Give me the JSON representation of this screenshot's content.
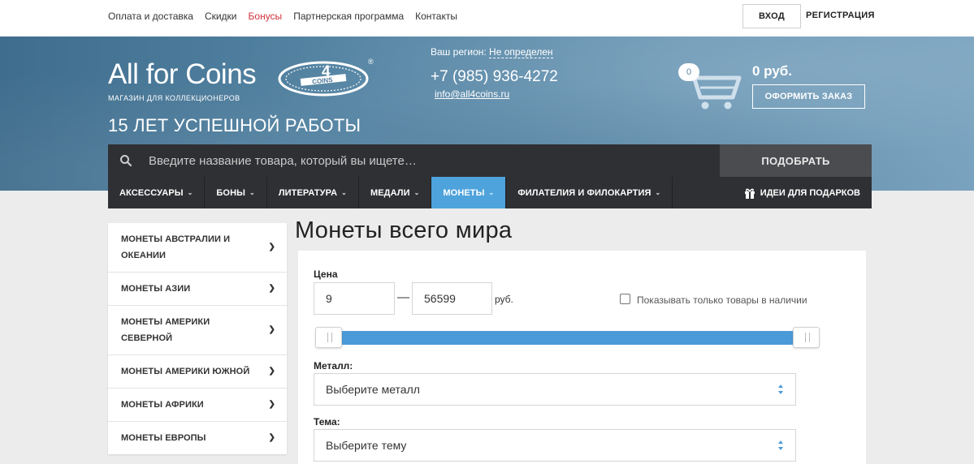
{
  "topbar": {
    "links": [
      "Оплата и доставка",
      "Скидки",
      "Бонусы",
      "Партнерская программа",
      "Контакты"
    ],
    "login": "ВХОД",
    "register": "РЕГИСТРАЦИЯ"
  },
  "header": {
    "logo": "All for Coins",
    "logo_sub": "МАГАЗИН ДЛЯ КОЛЛЕКЦИОНЕРОВ",
    "tagline": "15 ЛЕТ УСПЕШНОЙ РАБОТЫ",
    "region_label": "Ваш регион:",
    "region_value": "Не определен",
    "phone": "+7 (985) 936-4272",
    "email": "info@all4coins.ru",
    "cart_count": "0",
    "cart_sum": "0 руб.",
    "order_button": "ОФОРМИТЬ ЗАКАЗ"
  },
  "search": {
    "placeholder": "Введите название товара, который вы ищете…",
    "button": "ПОДОБРАТЬ"
  },
  "nav": {
    "items": [
      "АКСЕССУАРЫ",
      "БОНЫ",
      "ЛИТЕРАТУРА",
      "МЕДАЛИ",
      "МОНЕТЫ",
      "ФИЛАТЕЛИЯ И ФИЛОКАРТИЯ"
    ],
    "active": "МОНЕТЫ",
    "gift": "ИДЕИ ДЛЯ ПОДАРКОВ"
  },
  "sidebar": {
    "items": [
      "МОНЕТЫ АВСТРАЛИИ И ОКЕАНИИ",
      "МОНЕТЫ АЗИИ",
      "МОНЕТЫ АМЕРИКИ СЕВЕРНОЙ",
      "МОНЕТЫ АМЕРИКИ ЮЖНОЙ",
      "МОНЕТЫ АФРИКИ",
      "МОНЕТЫ ЕВРОПЫ"
    ]
  },
  "main": {
    "title": "Монеты всего мира",
    "price_label": "Цена",
    "price_min": "9",
    "price_max": "56599",
    "price_dash": "—",
    "currency": "руб.",
    "in_stock_label": "Показывать только товары в наличии",
    "in_stock_checked": false,
    "metal_label": "Металл:",
    "metal_placeholder": "Выберите металл",
    "theme_label": "Тема:",
    "theme_placeholder": "Выберите тему"
  },
  "colors": {
    "accent": "#4ea3dc",
    "dark": "#2e3033",
    "bonus_link": "#d2323a"
  }
}
